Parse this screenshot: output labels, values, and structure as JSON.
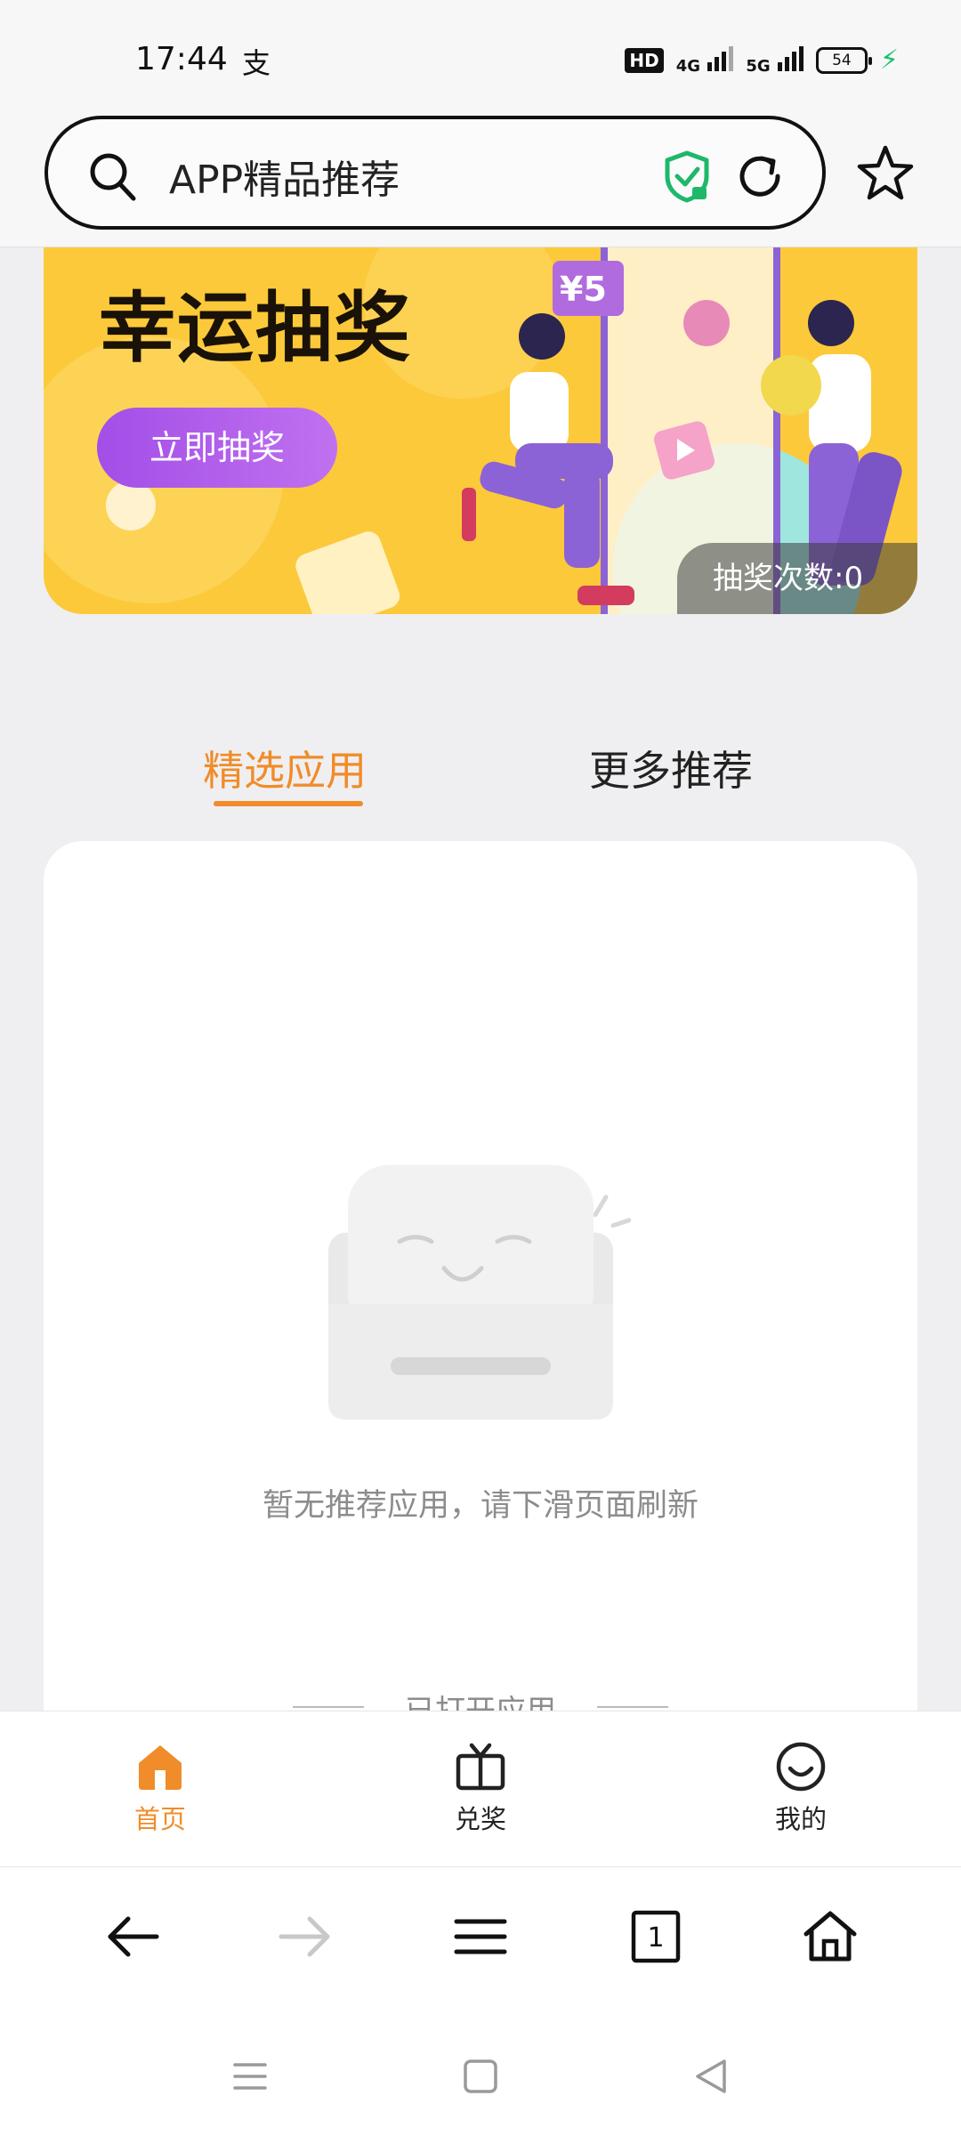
{
  "status_bar": {
    "time": "17:44",
    "alipay_glyph": "支",
    "hd_badge": "HD",
    "network_1": "4G",
    "network_2": "5G",
    "battery_level": "54"
  },
  "address_bar": {
    "title": "APP精品推荐",
    "icons": [
      "search-icon",
      "shield-check-icon",
      "refresh-icon",
      "star-icon"
    ]
  },
  "banner": {
    "title": "幸运抽奖",
    "button_label": "立即抽奖",
    "ticket_label": "¥5",
    "draw_count": "抽奖次数:0",
    "colors": {
      "background": "#fcc93a",
      "button": "#a34ee8"
    }
  },
  "tabs": [
    {
      "label": "精选应用",
      "active": true
    },
    {
      "label": "更多推荐",
      "active": false
    }
  ],
  "empty_state": {
    "message": "暂无推荐应用，请下滑页面刷新",
    "opened_apps_label": "已打开应用"
  },
  "app_nav": [
    {
      "label": "首页",
      "icon": "home-icon",
      "active": true
    },
    {
      "label": "兑奖",
      "icon": "gift-tv-icon",
      "active": false
    },
    {
      "label": "我的",
      "icon": "smile-icon",
      "active": false
    }
  ],
  "browser_toolbar": {
    "tab_count": "1",
    "icons": [
      "back-arrow-icon",
      "forward-arrow-icon",
      "menu-icon",
      "tabs-icon",
      "home-icon"
    ]
  },
  "theme": {
    "accent": "#f08c29"
  }
}
